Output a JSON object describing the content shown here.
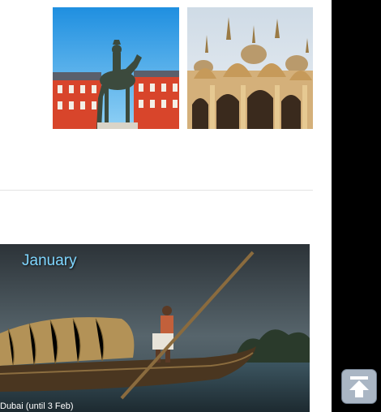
{
  "gallery": {
    "items": [
      {
        "name": "madrid-plaza-mayor-statue"
      },
      {
        "name": "venice-st-marks-basilica"
      }
    ]
  },
  "feature": {
    "month": "January",
    "caption": "Dubai (until 3 Feb)"
  },
  "back_to_top": {
    "icon": "arrow-up-to-bar-icon",
    "color": "#aab6c4"
  }
}
